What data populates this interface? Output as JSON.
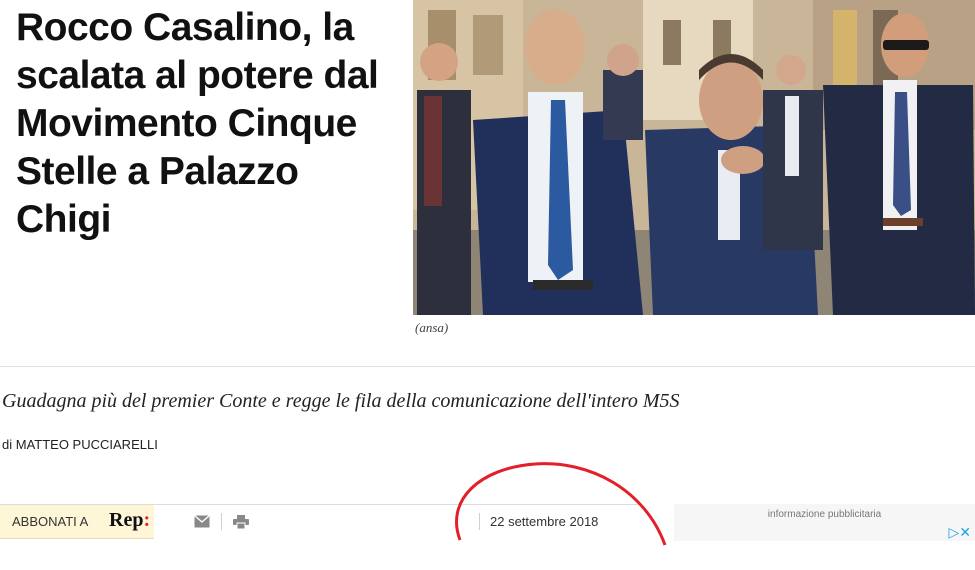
{
  "article": {
    "headline": "Rocco Casalino, la scalata al potere dal Movimento Cinque Stelle a Palazzo Chigi",
    "photo_caption": "(ansa)",
    "subtitle": "Guadagna più del premier Conte e regge le fila della comunicazione dell'intero M5S",
    "byline_prefix": "di",
    "author": "Matteo Pucciarelli",
    "date": "22 settembre 2018"
  },
  "toolbar": {
    "subscribe_label": "ABBONATI A",
    "logo_text": "Rep",
    "logo_colon": ":",
    "icons": [
      "envelope-icon",
      "print-icon"
    ]
  },
  "ad": {
    "label": "informazione pubblicitaria",
    "controls": "▷✕"
  },
  "colors": {
    "annotation_circle": "#e3202a",
    "subscribe_bg": "#fff6d8",
    "adchoices": "#1aa3e6"
  }
}
